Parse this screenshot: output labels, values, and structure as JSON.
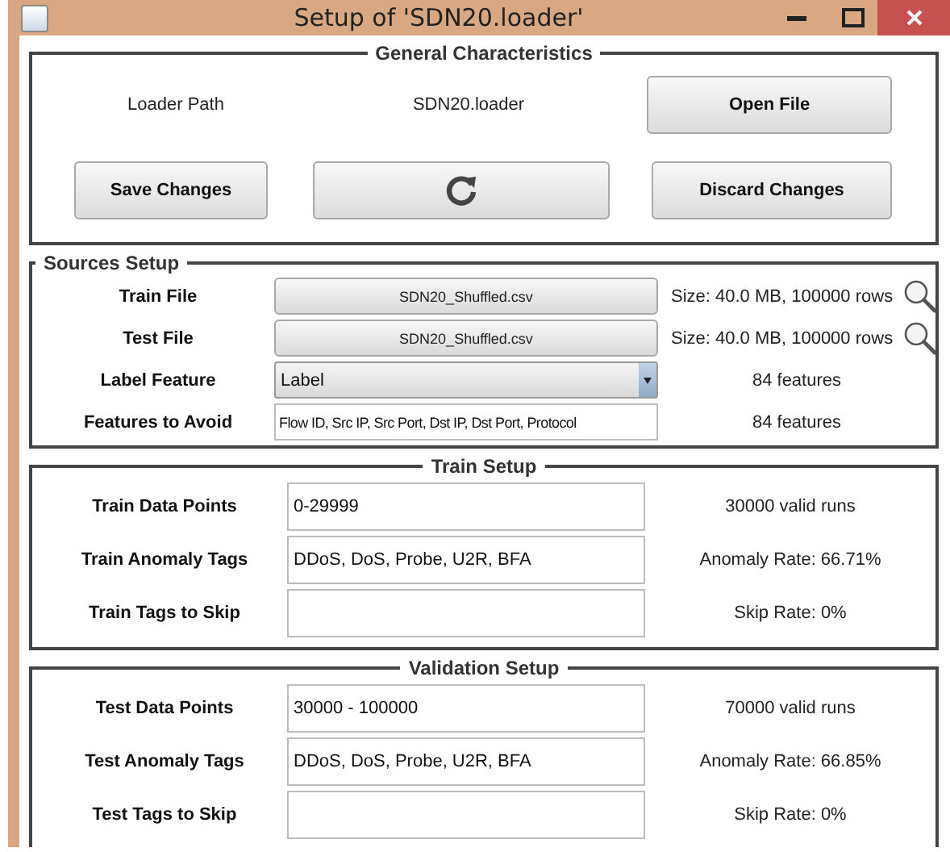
{
  "window": {
    "title": "Setup of 'SDN20.loader'"
  },
  "general": {
    "title": "General Characteristics",
    "path_label": "Loader Path",
    "path_value": "SDN20.loader",
    "open_button": "Open File",
    "save_button": "Save Changes",
    "discard_button": "Discard Changes"
  },
  "sources": {
    "title": "Sources Setup",
    "rows": [
      {
        "kind": "file",
        "label": "Train File",
        "value": "SDN20_Shuffled.csv",
        "info": "Size: 40.0 MB, 100000 rows"
      },
      {
        "kind": "file",
        "label": "Test File",
        "value": "SDN20_Shuffled.csv",
        "info": "Size: 40.0 MB, 100000 rows"
      },
      {
        "kind": "select",
        "label": "Label Feature",
        "value": "Label",
        "info": "84 features"
      },
      {
        "kind": "text",
        "label": "Features to Avoid",
        "value": "Flow ID, Src IP, Src Port, Dst IP, Dst Port, Protocol",
        "info": "84 features"
      }
    ]
  },
  "sections": [
    {
      "title": "Train Setup",
      "rows": [
        {
          "kind": "text",
          "label": "Train Data Points",
          "value": "0-29999",
          "info": "30000 valid runs"
        },
        {
          "kind": "text",
          "label": "Train Anomaly Tags",
          "value": "DDoS, DoS, Probe, U2R, BFA",
          "info": "Anomaly Rate: 66.71%"
        },
        {
          "kind": "text",
          "label": "Train Tags to Skip",
          "info": "Skip Rate: 0%"
        }
      ]
    },
    {
      "title": "Validation Setup",
      "rows": [
        {
          "kind": "text",
          "label": "Test Data Points",
          "value": "30000 - 100000",
          "info": "70000 valid runs"
        },
        {
          "kind": "text",
          "label": "Test Anomaly Tags",
          "value": "DDoS, DoS, Probe, U2R, BFA",
          "info": "Anomaly Rate: 66.85%"
        },
        {
          "kind": "text",
          "label": "Test Tags to Skip",
          "info": "Skip Rate: 0%"
        }
      ]
    }
  ]
}
